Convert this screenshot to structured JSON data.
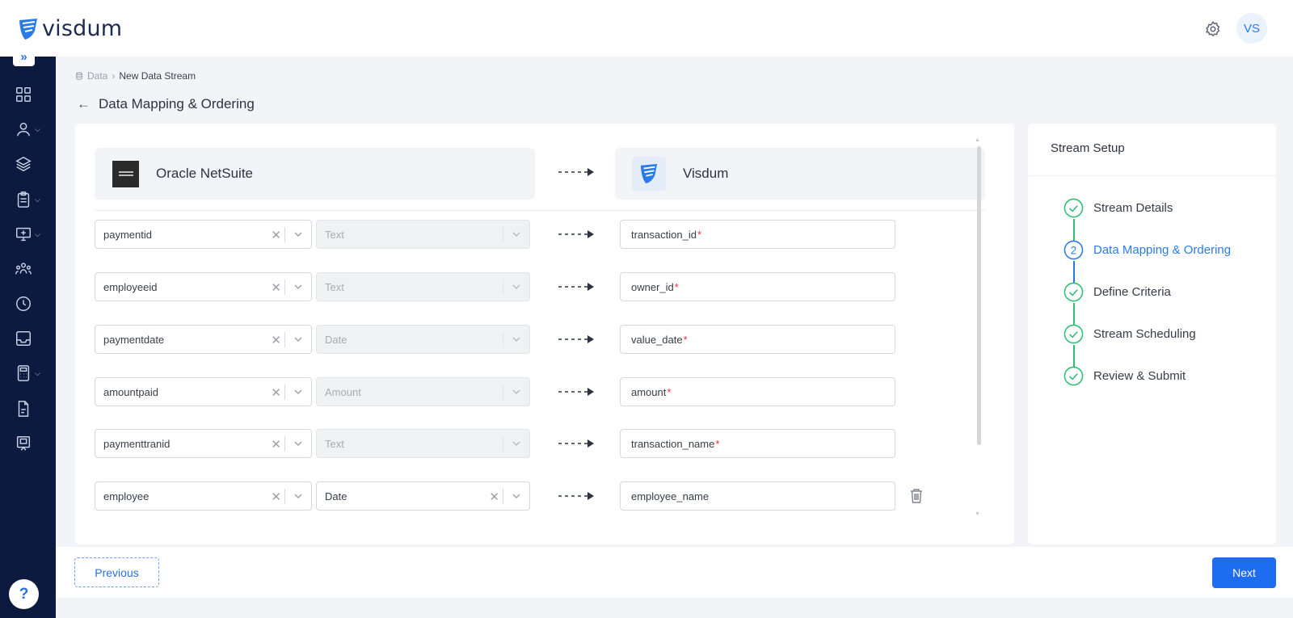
{
  "app": {
    "logo_text": "visdum",
    "avatar_initials": "VS",
    "brand_color": "#1e6cf0"
  },
  "breadcrumb": {
    "root": "Data",
    "current": "New Data Stream"
  },
  "page": {
    "title": "Data Mapping & Ordering"
  },
  "mapping": {
    "source_name": "Oracle NetSuite",
    "destination_name": "Visdum",
    "rows": [
      {
        "field": "paymentid",
        "type": "Text",
        "target": "transaction_id",
        "required": "*"
      },
      {
        "field": "employeeid",
        "type": "Text",
        "target": "owner_id",
        "required": "*"
      },
      {
        "field": "paymentdate",
        "type": "Date",
        "target": "value_date",
        "required": "*"
      },
      {
        "field": "amountpaid",
        "type": "Amount",
        "target": "amount",
        "required": "*"
      },
      {
        "field": "paymenttranid",
        "type": "Text",
        "target": "transaction_name",
        "required": "*"
      },
      {
        "field": "employee",
        "type": "Date",
        "target": "employee_name",
        "required": ""
      }
    ]
  },
  "setup": {
    "title": "Stream Setup",
    "steps": [
      {
        "label": "Stream Details",
        "state": "done"
      },
      {
        "label": "Data Mapping & Ordering",
        "state": "active",
        "number": "2"
      },
      {
        "label": "Define Criteria",
        "state": "done"
      },
      {
        "label": "Stream Scheduling",
        "state": "done"
      },
      {
        "label": "Review & Submit",
        "state": "done"
      }
    ],
    "done_color": "#2fbf71",
    "active_color": "#2a7bea"
  },
  "footer": {
    "previous_label": "Previous",
    "next_label": "Next"
  },
  "sidebar": {
    "expand_label": "»",
    "help_label": "?",
    "items": [
      {
        "icon": "dashboard-icon"
      },
      {
        "icon": "user-icon",
        "dropdown": true
      },
      {
        "icon": "layers-icon"
      },
      {
        "icon": "clipboard-icon",
        "dropdown": true
      },
      {
        "icon": "monitor-icon",
        "dropdown": true
      },
      {
        "icon": "team-icon"
      },
      {
        "icon": "clock-icon"
      },
      {
        "icon": "inbox-icon"
      },
      {
        "icon": "calculator-icon",
        "dropdown": true
      },
      {
        "icon": "document-icon"
      },
      {
        "icon": "presentation-icon"
      }
    ]
  }
}
